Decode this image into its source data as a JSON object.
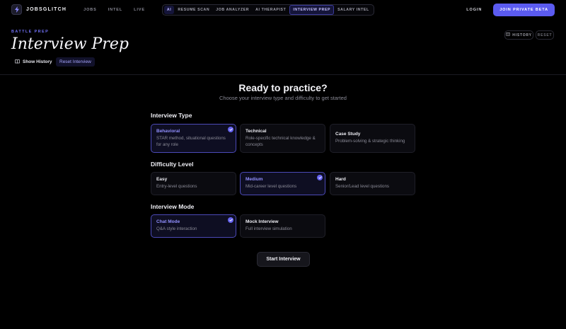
{
  "nav": {
    "logo_text": "JOBSGLITCH",
    "links": [
      "JOBS",
      "INTEL",
      "LIVE"
    ],
    "tools": [
      "AI",
      "RESUME SCAN",
      "JOB ANALYZER",
      "AI THERAPIST",
      "INTERVIEW PREP",
      "SALARY INTEL"
    ],
    "active_tool": "INTERVIEW PREP",
    "login": "LOGIN",
    "join": "JOIN PRIVATE BETA"
  },
  "header": {
    "eyebrow": "BATTLE PREP",
    "title": "Interview Prep",
    "show_history": "Show History",
    "reset_interview": "Reset Interview",
    "history_btn": "HISTORY",
    "reset_btn": "RESET"
  },
  "main": {
    "title": "Ready to practice?",
    "subtitle": "Choose your interview type and difficulty to get started",
    "interview_type": {
      "label": "Interview Type",
      "options": [
        {
          "title": "Behavioral",
          "desc": "STAR method, situational questions for any role",
          "selected": true
        },
        {
          "title": "Technical",
          "desc": "Role-specific technical knowledge & concepts",
          "selected": false
        },
        {
          "title": "Case Study",
          "desc": "Problem-solving & strategic thinking",
          "selected": false
        }
      ]
    },
    "difficulty": {
      "label": "Difficulty Level",
      "options": [
        {
          "title": "Easy",
          "desc": "Entry-level questions",
          "selected": false
        },
        {
          "title": "Medium",
          "desc": "Mid-career level questions",
          "selected": true
        },
        {
          "title": "Hard",
          "desc": "Senior/Lead level questions",
          "selected": false
        }
      ]
    },
    "mode": {
      "label": "Interview Mode",
      "options": [
        {
          "title": "Chat Mode",
          "desc": "Q&A style interaction",
          "selected": true
        },
        {
          "title": "Mock Interview",
          "desc": "Full interview simulation",
          "selected": false
        }
      ]
    },
    "start_button": "Start Interview"
  },
  "colors": {
    "accent": "#5b5bf0",
    "selected_border": "#4c4ab8",
    "background": "#000000"
  }
}
